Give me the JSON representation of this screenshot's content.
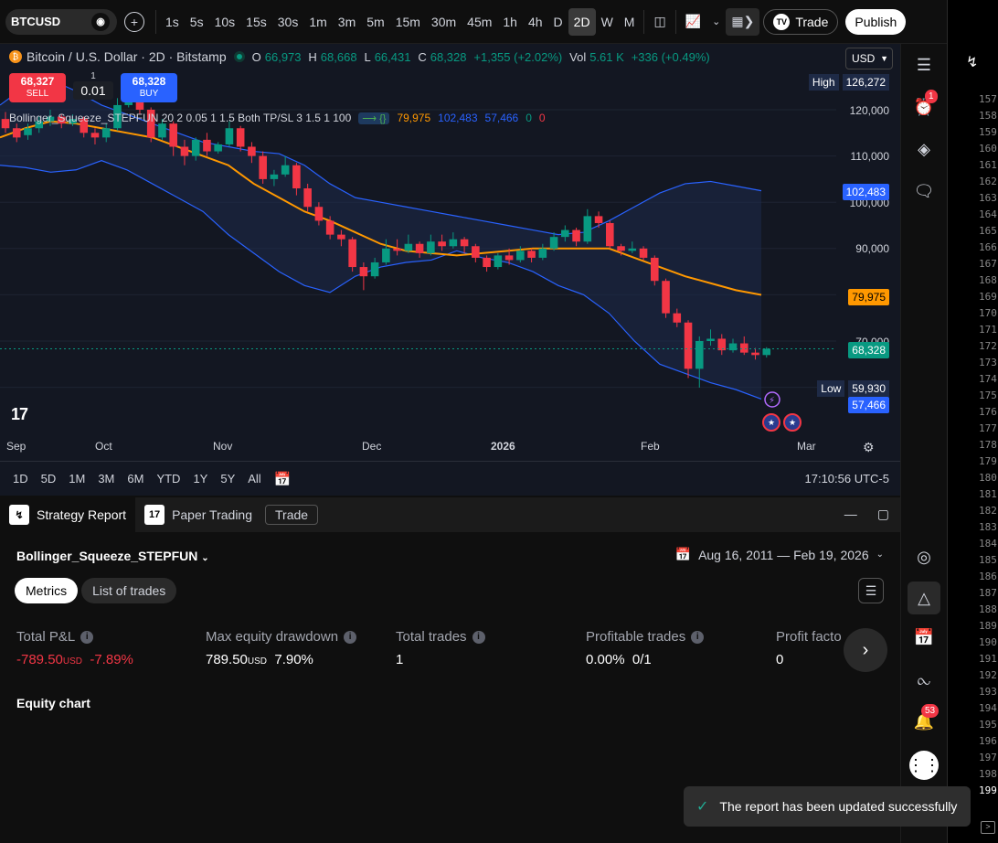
{
  "toolbar": {
    "symbol": "BTCUSD",
    "timeframes": [
      "1s",
      "5s",
      "10s",
      "15s",
      "30s",
      "1m",
      "3m",
      "5m",
      "15m",
      "30m",
      "45m",
      "1h",
      "4h",
      "D",
      "2D",
      "W",
      "M"
    ],
    "active_timeframe": "2D",
    "trade_label": "Trade",
    "publish_label": "Publish"
  },
  "legend": {
    "title": "Bitcoin / U.S. Dollar · 2D · Bitstamp",
    "open_label": "O",
    "open": "66,973",
    "high_label": "H",
    "high": "68,668",
    "low_label": "L",
    "low": "66,431",
    "close_label": "C",
    "close": "68,328",
    "change": "+1,355 (+2.02%)",
    "vol_label": "Vol",
    "vol": "5.61 K",
    "vol_change": "+336 (+0.49%)",
    "currency": "USD"
  },
  "order": {
    "sell_price": "68,327",
    "sell_label": "SELL",
    "buy_price": "68,328",
    "buy_label": "BUY",
    "qty_top": "1",
    "qty": "0.01"
  },
  "indicator": {
    "name": "Bollinger_Squeeze_STEPFUN 20 2 0.05 1 1.5 Both TP/SL 3 1.5 1 100",
    "v1": "79,975",
    "v2": "102,483",
    "v3": "57,466",
    "v4": "0",
    "v5": "0"
  },
  "price_axis": {
    "high_label": "High",
    "high_value": "126,272",
    "low_label": "Low",
    "low_value": "59,930",
    "ticks": [
      "120,000",
      "110,000",
      "100,000",
      "90,000",
      "70,000"
    ],
    "tag_upper": "102,483",
    "tag_mid": "79,975",
    "tag_price": "68,328",
    "tag_lower": "57,466"
  },
  "time_axis": [
    "Sep",
    "Oct",
    "Nov",
    "Dec",
    "2026",
    "Feb",
    "Mar"
  ],
  "ranges": [
    "1D",
    "5D",
    "1M",
    "3M",
    "6M",
    "YTD",
    "1Y",
    "5Y",
    "All"
  ],
  "clock": "17:10:56 UTC-5",
  "panel": {
    "tabs": [
      "Strategy Report",
      "Paper Trading"
    ],
    "trade_tab": "Trade",
    "strategy": "Bollinger_Squeeze_STEPFUN",
    "date_range": "Aug 16, 2011 — Feb 19, 2026",
    "seg": [
      "Metrics",
      "List of trades"
    ],
    "metrics": [
      {
        "title": "Total P&L",
        "value": "-789.50",
        "unit": "USD",
        "extra": "-7.89%"
      },
      {
        "title": "Max equity drawdown",
        "value": "789.50",
        "unit": "USD",
        "extra": "7.90%"
      },
      {
        "title": "Total trades",
        "value": "1",
        "unit": "",
        "extra": ""
      },
      {
        "title": "Profitable trades",
        "value": "0.00%",
        "unit": "",
        "extra": "0/1"
      },
      {
        "title": "Profit facto",
        "value": "0",
        "unit": "",
        "extra": ""
      }
    ],
    "equity_title": "Equity chart"
  },
  "sidebar": {
    "alert_badge": "1",
    "notif_badge": "53"
  },
  "line_numbers": [
    "157",
    "158",
    "159",
    "160",
    "161",
    "162",
    "163",
    "164",
    "165",
    "166",
    "167",
    "168",
    "169",
    "170",
    "171",
    "172",
    "173",
    "174",
    "175",
    "176",
    "177",
    "178",
    "179",
    "180",
    "181",
    "182",
    "183",
    "184",
    "185",
    "186",
    "187",
    "188",
    "189",
    "190",
    "191",
    "192",
    "193",
    "194",
    "195",
    "196",
    "197",
    "198",
    "199"
  ],
  "toast": "The report has been updated successfully",
  "chart_data": {
    "type": "candlestick",
    "ylim": [
      55000,
      130000
    ],
    "candles": [
      [
        118000,
        116000,
        119500,
        115000
      ],
      [
        116000,
        114000,
        117000,
        113000
      ],
      [
        114500,
        116000,
        117000,
        113500
      ],
      [
        116000,
        117500,
        118500,
        115000
      ],
      [
        117500,
        118500,
        120000,
        116500
      ],
      [
        118500,
        117000,
        119000,
        116000
      ],
      [
        117000,
        118000,
        119000,
        116500
      ],
      [
        118000,
        115000,
        118500,
        114000
      ],
      [
        115000,
        114000,
        116000,
        112500
      ],
      [
        114000,
        116000,
        117000,
        113000
      ],
      [
        116000,
        121000,
        122500,
        115500
      ],
      [
        121000,
        124000,
        126272,
        120500
      ],
      [
        124000,
        120000,
        124500,
        119000
      ],
      [
        120000,
        114000,
        120500,
        113000
      ],
      [
        114000,
        117000,
        118000,
        113500
      ],
      [
        117000,
        112000,
        117500,
        110000
      ],
      [
        112000,
        110000,
        113500,
        108000
      ],
      [
        110000,
        113500,
        114000,
        109000
      ],
      [
        113500,
        111000,
        115000,
        110000
      ],
      [
        111000,
        112500,
        113000,
        110500
      ],
      [
        112500,
        116000,
        117500,
        112000
      ],
      [
        116000,
        112000,
        116500,
        111000
      ],
      [
        112000,
        110000,
        113000,
        108500
      ],
      [
        110000,
        105000,
        111000,
        104000
      ],
      [
        105000,
        106000,
        107000,
        103500
      ],
      [
        106000,
        108000,
        110000,
        105500
      ],
      [
        108000,
        103000,
        108500,
        101500
      ],
      [
        103000,
        99000,
        104000,
        98000
      ],
      [
        99000,
        96000,
        100000,
        95000
      ],
      [
        96000,
        93000,
        97000,
        92000
      ],
      [
        93000,
        92000,
        94000,
        90500
      ],
      [
        92000,
        86000,
        92500,
        85000
      ],
      [
        86000,
        84000,
        87000,
        81000
      ],
      [
        84000,
        87000,
        88000,
        83500
      ],
      [
        87000,
        90000,
        92000,
        86500
      ],
      [
        90000,
        89500,
        92000,
        88500
      ],
      [
        89500,
        91000,
        93000,
        89000
      ],
      [
        91000,
        89000,
        91500,
        88000
      ],
      [
        89000,
        91500,
        93000,
        88500
      ],
      [
        91500,
        90500,
        93000,
        89500
      ],
      [
        90500,
        92000,
        93500,
        90000
      ],
      [
        92000,
        90500,
        92500,
        89000
      ],
      [
        90500,
        88000,
        91000,
        87000
      ],
      [
        88000,
        86000,
        88500,
        85000
      ],
      [
        86000,
        88500,
        89000,
        85500
      ],
      [
        88500,
        87500,
        90000,
        86500
      ],
      [
        87500,
        89500,
        90500,
        87000
      ],
      [
        89500,
        88000,
        90000,
        87000
      ],
      [
        88000,
        90000,
        91000,
        87500
      ],
      [
        90000,
        92500,
        93500,
        89500
      ],
      [
        92500,
        94000,
        95000,
        91500
      ],
      [
        94000,
        91500,
        94500,
        90500
      ],
      [
        91500,
        97000,
        98500,
        91000
      ],
      [
        97000,
        95500,
        98000,
        94500
      ],
      [
        95500,
        90500,
        96000,
        90000
      ],
      [
        90500,
        89500,
        91000,
        88500
      ],
      [
        89500,
        90000,
        91500,
        89000
      ],
      [
        90000,
        88000,
        90500,
        87500
      ],
      [
        88000,
        83000,
        88500,
        82000
      ],
      [
        83000,
        76000,
        83500,
        75000
      ],
      [
        76000,
        74000,
        77000,
        73000
      ],
      [
        74000,
        64000,
        74500,
        62000
      ],
      [
        64000,
        70000,
        71000,
        59930
      ],
      [
        70000,
        70500,
        72500,
        69000
      ],
      [
        70500,
        68000,
        71500,
        67000
      ],
      [
        68000,
        69500,
        70500,
        67500
      ],
      [
        69500,
        67500,
        71000,
        67000
      ],
      [
        67500,
        66973,
        68500,
        66000
      ],
      [
        66973,
        68328,
        68668,
        66431
      ]
    ],
    "upper_band": [
      121000,
      125000,
      126500,
      124000,
      121000,
      119000,
      117000,
      115000,
      113000,
      112000,
      111000,
      110500,
      108000,
      104000,
      101000,
      100000,
      99000,
      98000,
      97000,
      96000,
      95000,
      94000,
      93000,
      93500,
      96000,
      99000,
      102000,
      104000,
      104500,
      103500,
      102483
    ],
    "lower_band": [
      108000,
      107500,
      106500,
      107000,
      109000,
      107000,
      104000,
      101000,
      98000,
      93000,
      89000,
      85000,
      82000,
      80500,
      84000,
      86000,
      87000,
      87500,
      89500,
      88000,
      87000,
      85000,
      82000,
      80000,
      76000,
      70000,
      65000,
      63000,
      61000,
      59500,
      57466
    ],
    "basis": [
      114000,
      116000,
      117500,
      117000,
      116000,
      115000,
      114000,
      112000,
      110000,
      108000,
      104000,
      101000,
      98000,
      96000,
      93500,
      91000,
      89500,
      89000,
      88500,
      89000,
      89500,
      90000,
      90000,
      90000,
      90000,
      88000,
      86000,
      84000,
      82500,
      81000,
      79975
    ]
  }
}
